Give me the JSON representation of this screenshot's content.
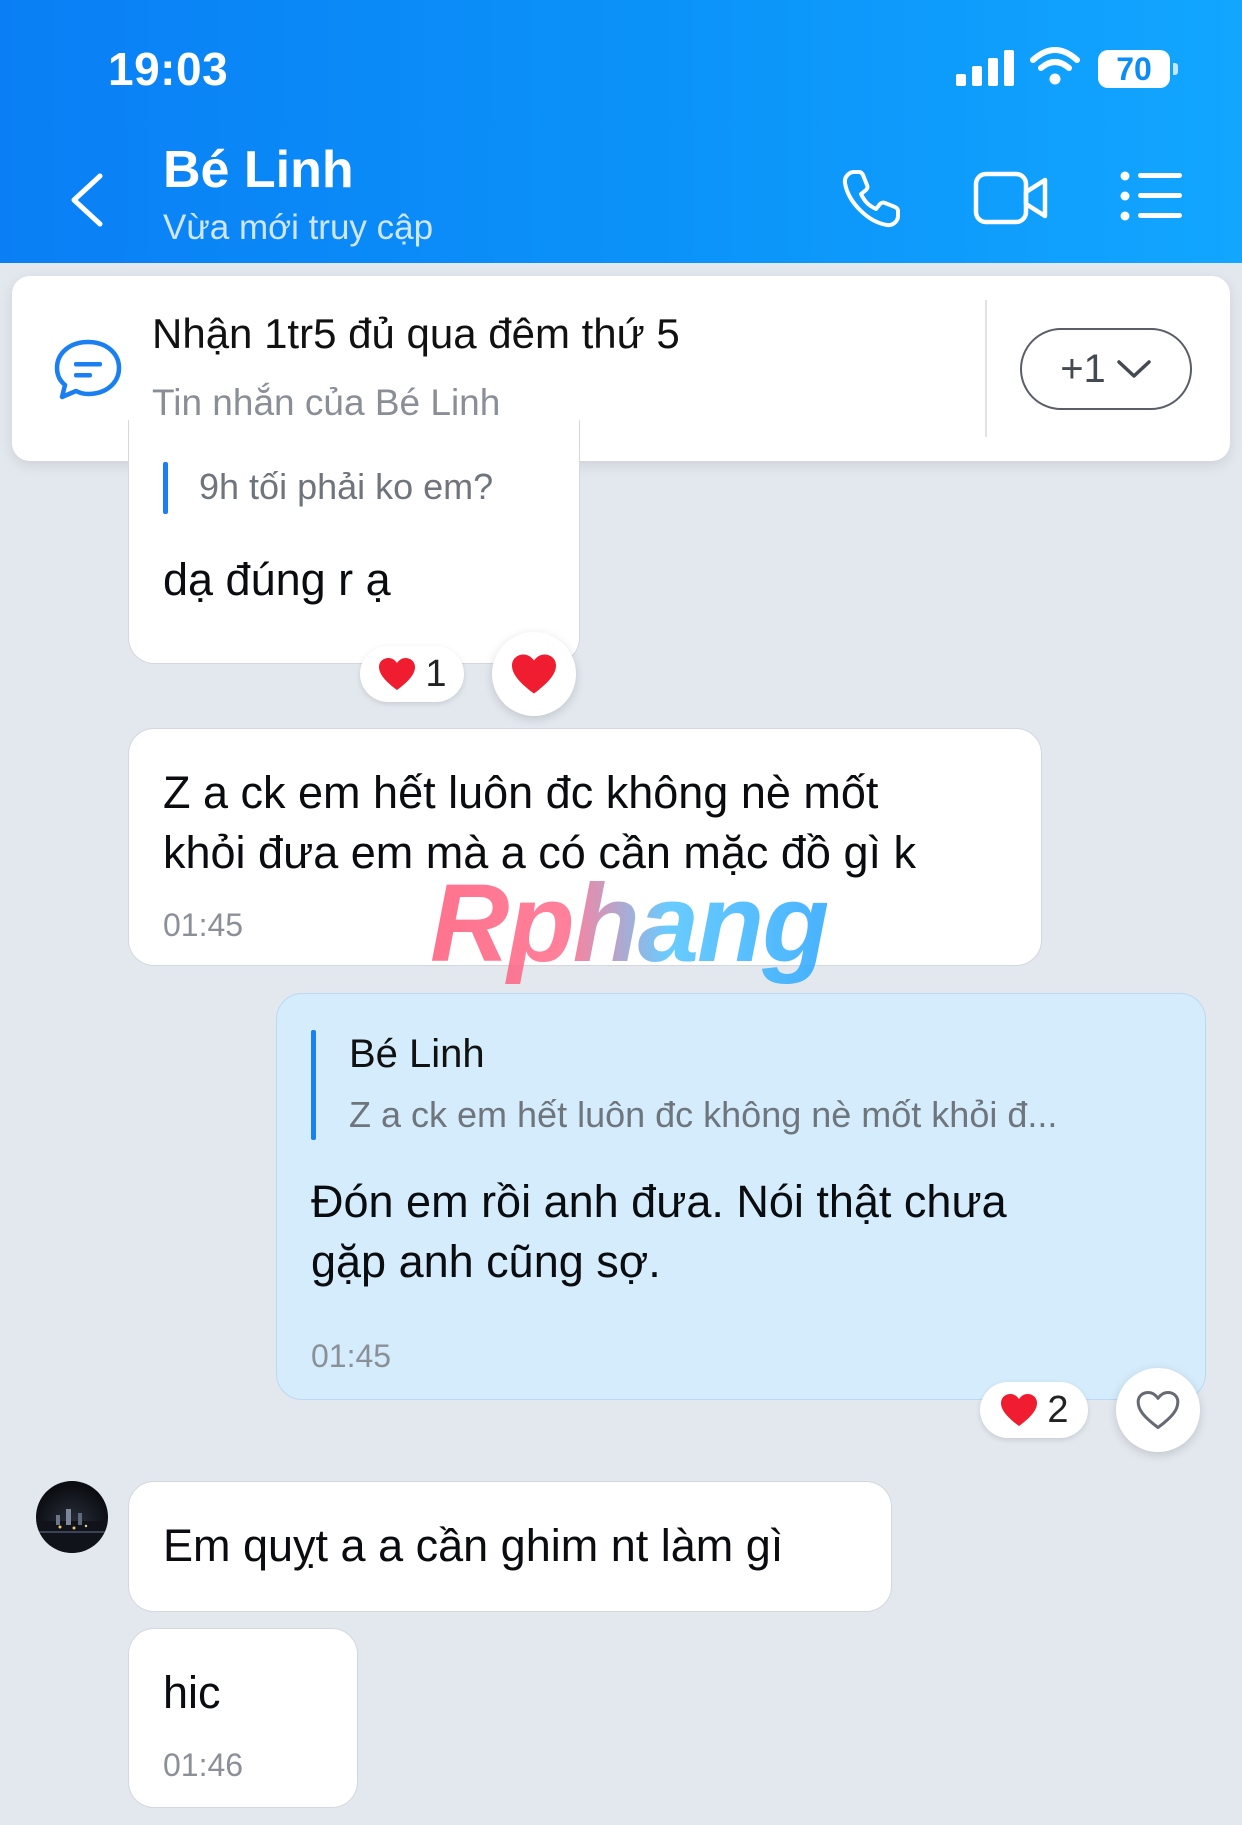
{
  "status_bar": {
    "time": "19:03",
    "battery": "70"
  },
  "header": {
    "contact_name": "Bé Linh",
    "contact_status": "Vừa mới truy cập"
  },
  "pinned": {
    "title": "Nhận 1tr5 đủ qua đêm thứ 5",
    "subtitle": "Tin nhắn của Bé Linh",
    "more_label": "+1"
  },
  "messages": [
    {
      "from": "them",
      "quote": "9h tối phải ko em?",
      "text": "dạ đúng r ạ",
      "reaction_count": "1"
    },
    {
      "from": "them",
      "text_line1": "Z a ck em hết luôn đc không nè mốt",
      "text_line2": "khỏi đưa em mà a có cần mặc đồ gì k",
      "time": "01:45"
    },
    {
      "from": "me",
      "quote_name": "Bé Linh",
      "quote": "Z a ck em hết luôn đc không nè mốt khỏi đ...",
      "text_line1": "Đón em rồi anh đưa. Nói thật chưa",
      "text_line2": "gặp anh cũng sợ.",
      "time": "01:45",
      "reaction_count": "2"
    },
    {
      "from": "them",
      "text": "Em quỵt a a cần ghim nt làm gì"
    },
    {
      "from": "them",
      "text": "hic",
      "time": "01:46"
    }
  ],
  "watermark": "Rphang",
  "colors": {
    "header": "#0b8cf7",
    "accent": "#1a7ff0",
    "my_bubble": "#d4ecfb",
    "heart": "#ef1d2f"
  }
}
